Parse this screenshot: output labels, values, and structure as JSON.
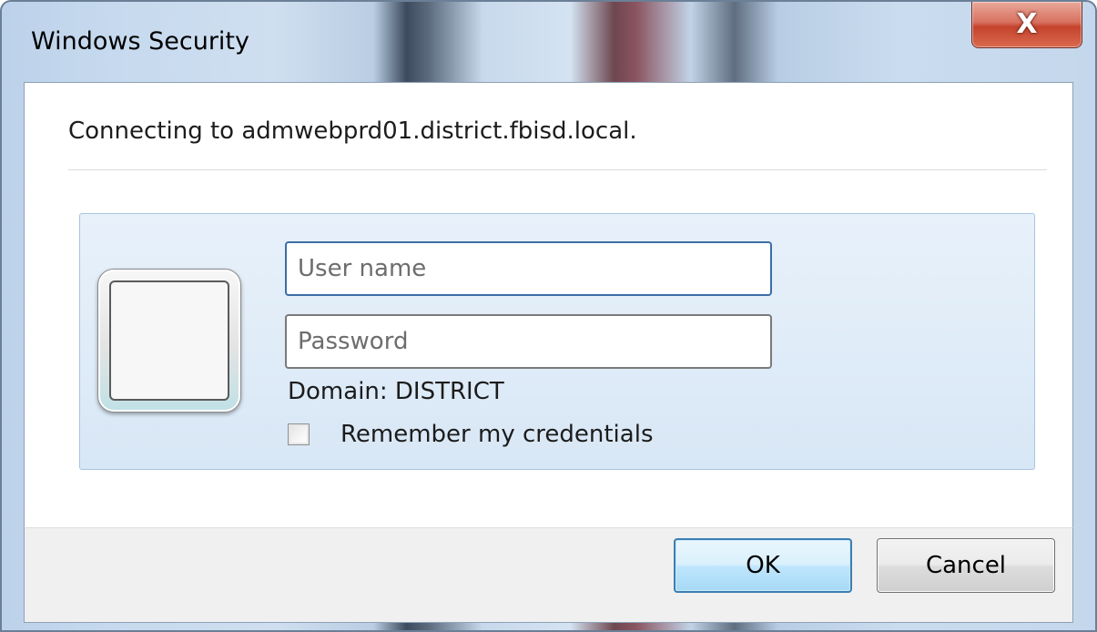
{
  "window": {
    "title": "Windows Security",
    "close_label": "X"
  },
  "message": {
    "connecting": "Connecting to admwebprd01.district.fbisd.local."
  },
  "credentials": {
    "username_placeholder": "User name",
    "username_value": "",
    "password_placeholder": "Password",
    "password_value": "",
    "domain": "Domain: DISTRICT",
    "remember_label": "Remember my credentials",
    "remember_checked": false
  },
  "buttons": {
    "ok": "OK",
    "cancel": "Cancel"
  },
  "icons": {
    "close": "close-icon",
    "user_tile": "user-tile-icon"
  },
  "colors": {
    "close_button": "#c5432d",
    "ok_border": "#3c7fb1",
    "panel_border": "#a8c5e2"
  }
}
